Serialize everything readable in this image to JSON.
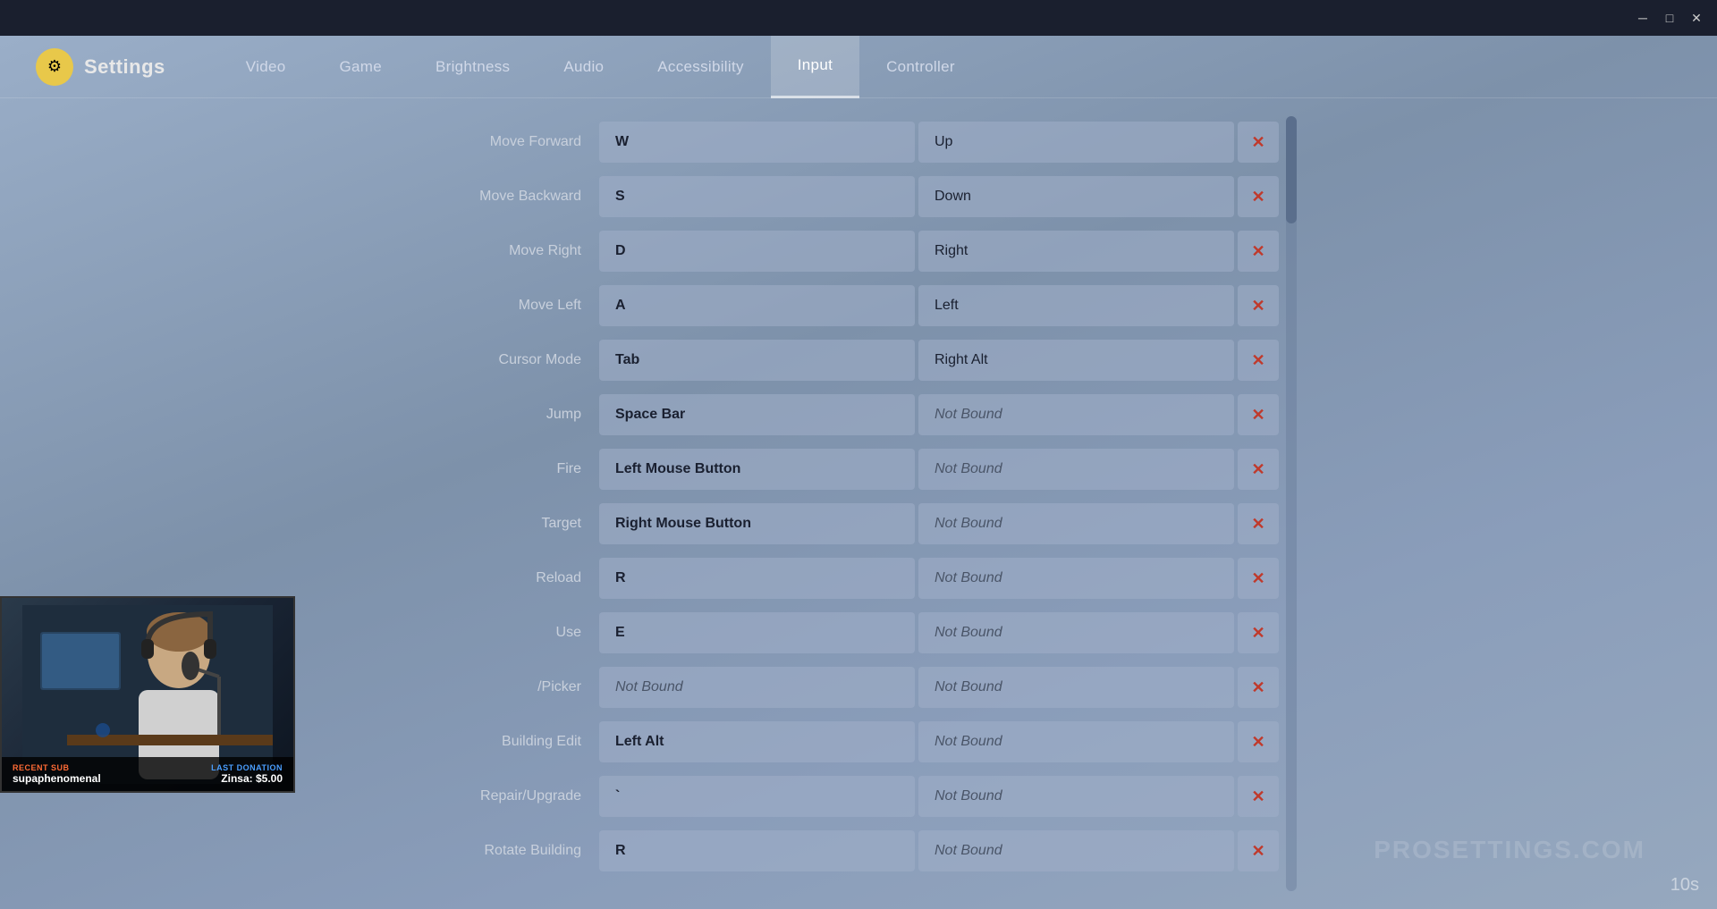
{
  "titlebar": {
    "minimize_label": "─",
    "maximize_label": "□",
    "close_label": "✕"
  },
  "header": {
    "logo_text": "Settings",
    "nav_tabs": [
      {
        "label": "Video",
        "active": false
      },
      {
        "label": "Game",
        "active": false
      },
      {
        "label": "Brightness",
        "active": false
      },
      {
        "label": "Audio",
        "active": false
      },
      {
        "label": "Accessibility",
        "active": false
      },
      {
        "label": "Input",
        "active": true
      },
      {
        "label": "Controller",
        "active": false
      }
    ]
  },
  "bindings": [
    {
      "action": "Move Forward",
      "key1": "W",
      "key2": "Up",
      "notbound1": false,
      "notbound2": false
    },
    {
      "action": "Move Backward",
      "key1": "S",
      "key2": "Down",
      "notbound1": false,
      "notbound2": false
    },
    {
      "action": "Move Right",
      "key1": "D",
      "key2": "Right",
      "notbound1": false,
      "notbound2": false
    },
    {
      "action": "Move Left",
      "key1": "A",
      "key2": "Left",
      "notbound1": false,
      "notbound2": false
    },
    {
      "action": "Cursor Mode",
      "key1": "Tab",
      "key2": "Right Alt",
      "notbound1": false,
      "notbound2": false
    },
    {
      "action": "Jump",
      "key1": "Space Bar",
      "key2": "Not Bound",
      "notbound1": false,
      "notbound2": true
    },
    {
      "action": "Fire",
      "key1": "Left Mouse Button",
      "key2": "Not Bound",
      "notbound1": false,
      "notbound2": true
    },
    {
      "action": "Target",
      "key1": "Right Mouse Button",
      "key2": "Not Bound",
      "notbound1": false,
      "notbound2": true
    },
    {
      "action": "Reload",
      "key1": "R",
      "key2": "Not Bound",
      "notbound1": false,
      "notbound2": true
    },
    {
      "action": "Use",
      "key1": "E",
      "key2": "Not Bound",
      "notbound1": false,
      "notbound2": true
    },
    {
      "action": "/Picker",
      "key1": "Not Bound",
      "key2": "Not Bound",
      "notbound1": true,
      "notbound2": true
    },
    {
      "action": "Building Edit",
      "key1": "Left Alt",
      "key2": "Not Bound",
      "notbound1": false,
      "notbound2": true
    },
    {
      "action": "Repair/Upgrade",
      "key1": "`",
      "key2": "Not Bound",
      "notbound1": false,
      "notbound2": true
    },
    {
      "action": "Rotate Building",
      "key1": "R",
      "key2": "Not Bound",
      "notbound1": false,
      "notbound2": true
    }
  ],
  "webcam": {
    "recent_sub_label": "RECENT SUB",
    "recent_sub_name": "supaphenomenal",
    "donation_label": "LAST DONATION",
    "donation_value": "Zinsa: $5.00"
  },
  "watermark": "PROSETTINGS.COM",
  "timer": "10s",
  "clear_btn_icon": "✕"
}
